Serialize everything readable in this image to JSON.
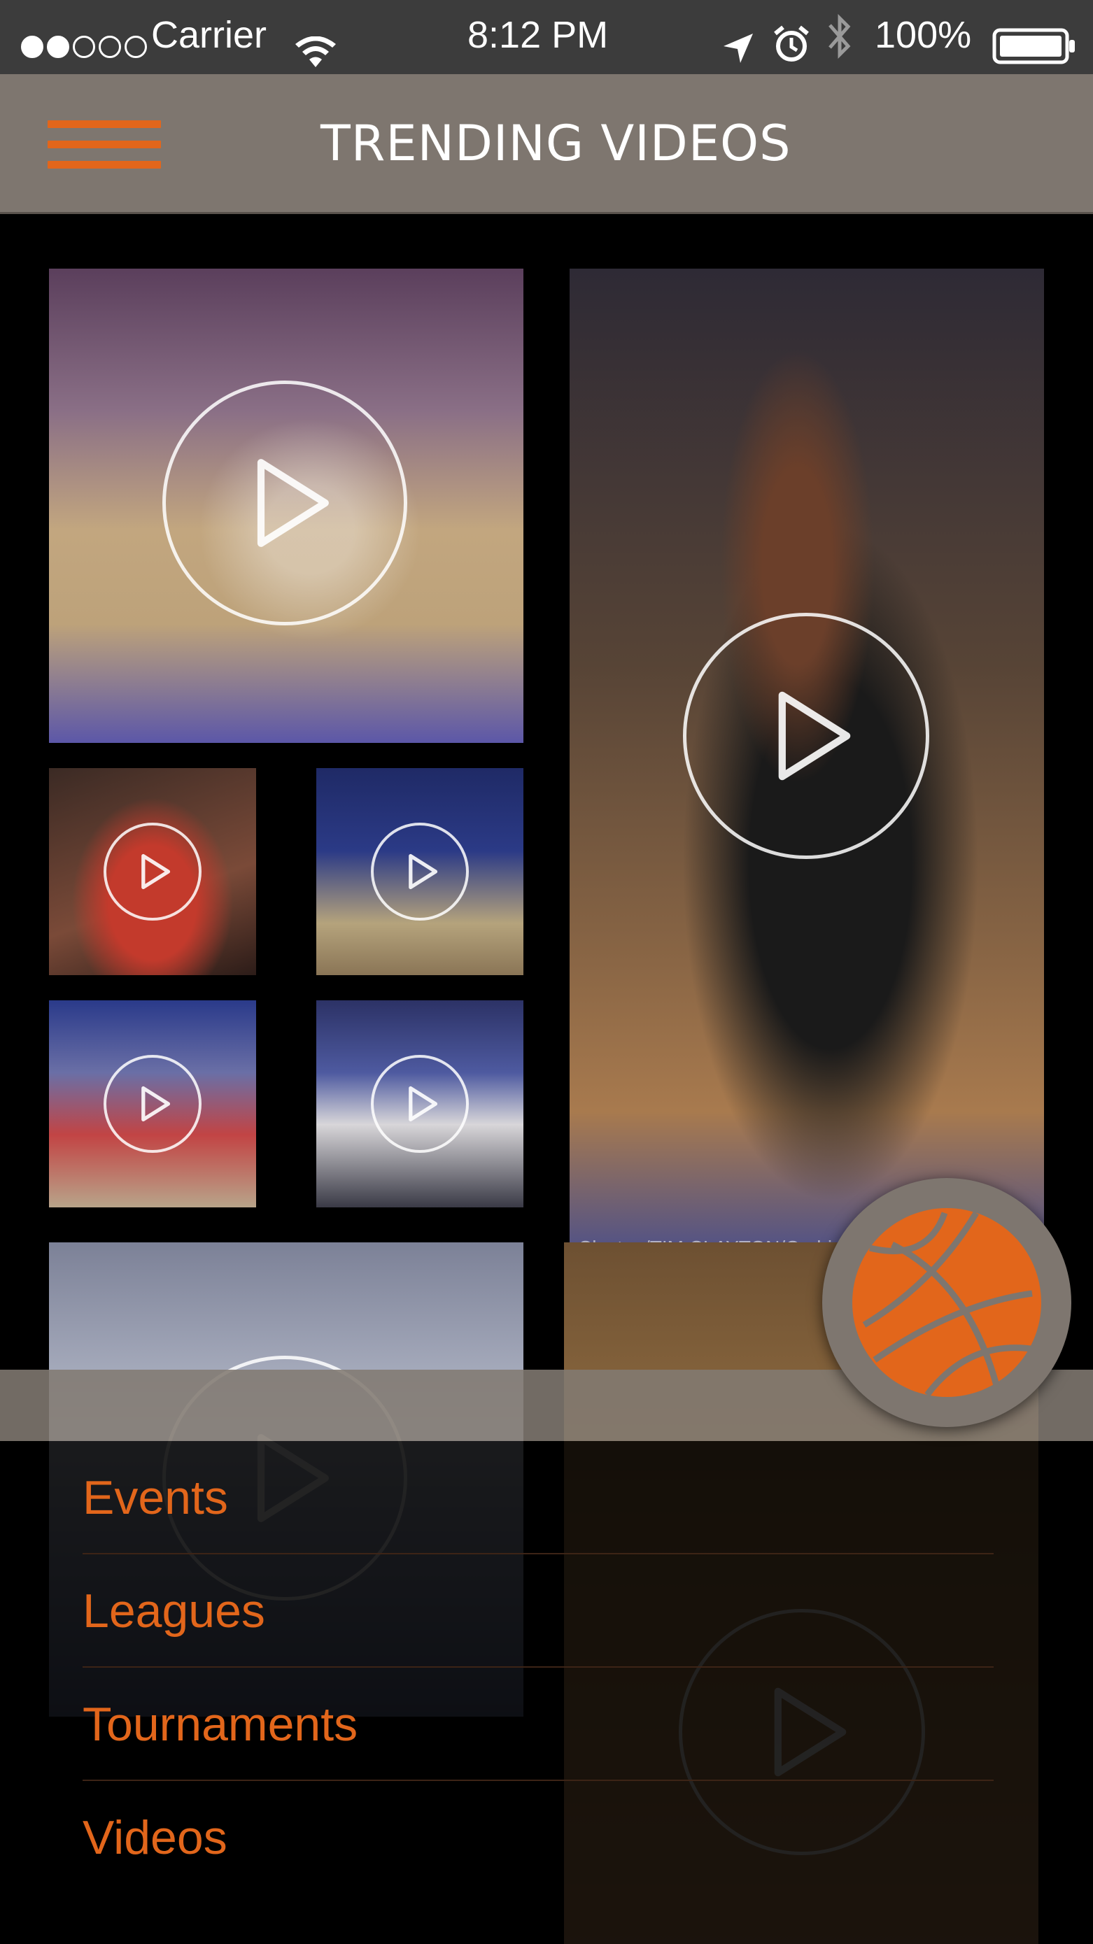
{
  "status_bar": {
    "carrier": "Carrier",
    "time": "8:12 PM",
    "battery": "100%",
    "signal_dots_filled": 2,
    "signal_dots_total": 5,
    "icons": [
      "wifi-icon",
      "location-arrow-icon",
      "alarm-icon",
      "bluetooth-icon",
      "battery-icon"
    ]
  },
  "header": {
    "title": "TRENDING VIDEOS",
    "menu_icon": "hamburger-icon"
  },
  "videos": [
    {
      "name": "video-tile-1",
      "icon": "play-icon"
    },
    {
      "name": "video-tile-2",
      "icon": "play-icon",
      "caption": "Clayton/TIM CLAYTON/Corbi"
    },
    {
      "name": "video-tile-3",
      "icon": "play-icon"
    },
    {
      "name": "video-tile-4",
      "icon": "play-icon"
    },
    {
      "name": "video-tile-5",
      "icon": "play-icon"
    },
    {
      "name": "video-tile-6",
      "icon": "play-icon"
    },
    {
      "name": "video-tile-7",
      "icon": "play-icon"
    },
    {
      "name": "video-tile-8",
      "icon": "play-icon"
    }
  ],
  "fab": {
    "icon": "basketball-icon"
  },
  "menu": {
    "items": [
      {
        "label": "Events"
      },
      {
        "label": "Leagues"
      },
      {
        "label": "Tournaments"
      },
      {
        "label": "Videos"
      }
    ]
  },
  "colors": {
    "accent": "#e2661b",
    "nav_background": "#7e766f",
    "status_background": "#3c3c3c",
    "page_background": "#000000"
  }
}
